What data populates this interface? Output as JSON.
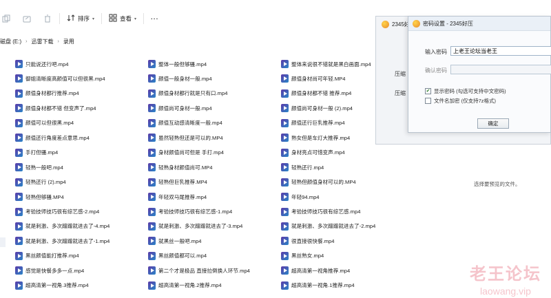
{
  "toolbar": {
    "sort_label": "排序",
    "view_label": "查看",
    "more_label": "···"
  },
  "breadcrumb": [
    "磁盘 (E:)",
    "迅雷下载",
    "录用"
  ],
  "files": [
    [
      "只能说还行吧.mp4",
      "整体一般但够骚.mp4",
      "整体来说很不错就是黑白画面.mp4"
    ],
    [
      "御姐清晰度高颜值可以但很黑.mp4",
      "颜值一般身材一般.mp4",
      "颜值身材尚可年轻.MP4"
    ],
    [
      "颜值身材都行推荐.mp4",
      "颜值身材都行就是只有口.mp4",
      "颜值身材都不错 推荐.mp4"
    ],
    [
      "颜值身材都不错 但变声了.mp4",
      "颜值尚可身材一般.mp4",
      "颜值尚可身材一般 (2).mp4"
    ],
    [
      "颜值可以但很黑.mp4",
      "颜值互动感清晰度一般.mp4",
      "颜值还行巨乳推荐.mp4"
    ],
    [
      "颜值还行角度差点意思.mp4",
      "虽然轻熟但还是可以的.MP4",
      "熟女但是车灯大推荐.mp4"
    ],
    [
      "手打但骚.mp4",
      "身材颜值尚可但是 手打.mp4",
      "身材亮点可惜变声.mp4"
    ],
    [
      "轻熟一般吧.mp4",
      "轻熟身材颜值尚可.MP4",
      "轻熟还行.mp4"
    ],
    [
      "轻熟还行 (2).mp4",
      "轻熟但巨乳推荐.MP4",
      "轻熟但颜值身材可以的.MP4"
    ],
    [
      "轻熟但够骚.MP4",
      "年轻双马尾推荐.mp4",
      "年轻94.mp4"
    ],
    [
      "考验技师技巧很有综艺感-2.mp4",
      "考验技师技巧很有综艺感-1.mp4",
      "考验技师技巧很有综艺感.mp4"
    ],
    [
      "就是刺激、多次蹭蹭就进去了-4.mp4",
      "就是刺激、多次蹭蹭就进去了-3.mp4",
      "就是刺激、多次蹭蹭就进去了-2.mp4"
    ],
    [
      "就是刺激、多次蹭蹭就进去了-1.mp4",
      "就黑丝一般吧.mp4",
      "很直接很快餐.mp4"
    ],
    [
      "黑丝颜值能打推荐.mp4",
      "黑丝颜值都可以.mp4",
      "黑丝熟女.mp4"
    ],
    [
      "感觉是快餐多多一点.mp4",
      "第二个才是极品 直接拉倒换人环节.mp4",
      "超高清第一视角推荐.mp4"
    ],
    [
      "超高清第一视角.3推荐.mp4",
      "超高清第一视角.2推荐.mp4",
      "超高清第一视角.1推荐.mp4"
    ]
  ],
  "preview_hint": "选择要预览的文件。",
  "bg_window": {
    "title": "2345好",
    "label1": "压缩",
    "label2": "压缩"
  },
  "dialog": {
    "title": "密码设置 - 2345好压",
    "password_label": "输入密码",
    "password_value": "上老王论坛当老王",
    "confirm_label": "确认密码",
    "confirm_value": "",
    "show_password_label": "显示密码 (勾选可支持中文密码)",
    "show_password_checked": true,
    "encrypt_names_label": "文件名加密 (仅支持7z格式)",
    "encrypt_names_checked": false,
    "ok_label": "确定"
  },
  "watermark": {
    "cn": "老王论坛",
    "en": "laowang.vip"
  }
}
